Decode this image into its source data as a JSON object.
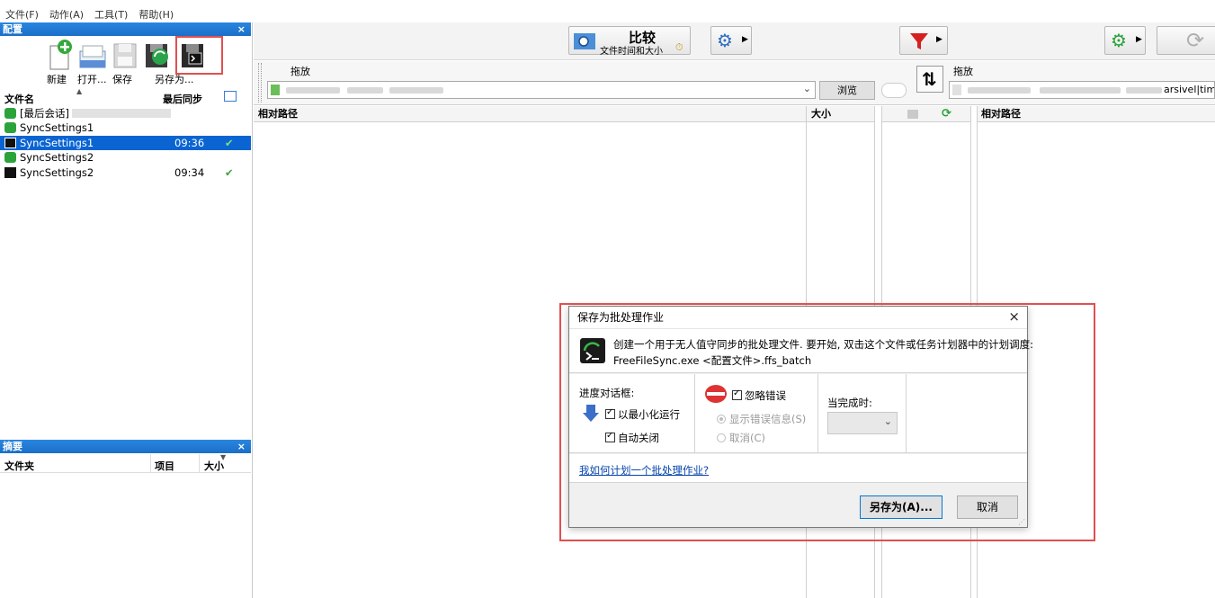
{
  "menubar": {
    "items": [
      "文件(F)",
      "动作(A)",
      "工具(T)",
      "帮助(H)"
    ]
  },
  "config_panel": {
    "title": "配置",
    "close": "×",
    "toolbar": {
      "new": "新建",
      "open": "打开...",
      "save": "保存",
      "save_as": "另存为..."
    },
    "columns": {
      "name": "文件名",
      "last_sync": "最后同步"
    },
    "rows": [
      {
        "name": "[最后会话]",
        "time": "",
        "check": ""
      },
      {
        "name": "SyncSettings1",
        "time": "",
        "check": ""
      },
      {
        "name": "SyncSettings1",
        "time": "09:36",
        "check": "✔"
      },
      {
        "name": "SyncSettings2",
        "time": "",
        "check": ""
      },
      {
        "name": "SyncSettings2",
        "time": "09:34",
        "check": "✔"
      }
    ]
  },
  "summary_panel": {
    "title": "摘要",
    "close": "×",
    "columns": {
      "folder": "文件夹",
      "items": "项目",
      "size": "大小"
    }
  },
  "top_toolbar": {
    "compare": "比较",
    "compare_sub": "文件时间和大小"
  },
  "folder_bar": {
    "left_drop": "拖放",
    "browse": "浏览",
    "right_drop": "拖放",
    "right_path_suffix": "arsivel|time"
  },
  "grid": {
    "left_rel_path": "相对路径",
    "left_size": "大小",
    "right_rel_path": "相对路径"
  },
  "dialog": {
    "title": "保存为批处理作业",
    "close": "×",
    "info_line1": "创建一个用于无人值守同步的批处理文件. 要开始, 双击这个文件或任务计划器中的计划调度:",
    "info_line2": "FreeFileSync.exe <配置文件>.ffs_batch",
    "progress_label": "进度对话框:",
    "run_minimized": "以最小化运行",
    "auto_close": "自动关闭",
    "ignore_errors": "忽略错误",
    "show_error_msg": "显示错误信息(S)",
    "cancel_option": "取消(C)",
    "on_completion": "当完成时:",
    "help_link": "我如何计划一个批处理作业?",
    "save_as_button": "另存为(A)...",
    "cancel_button": "取消"
  }
}
